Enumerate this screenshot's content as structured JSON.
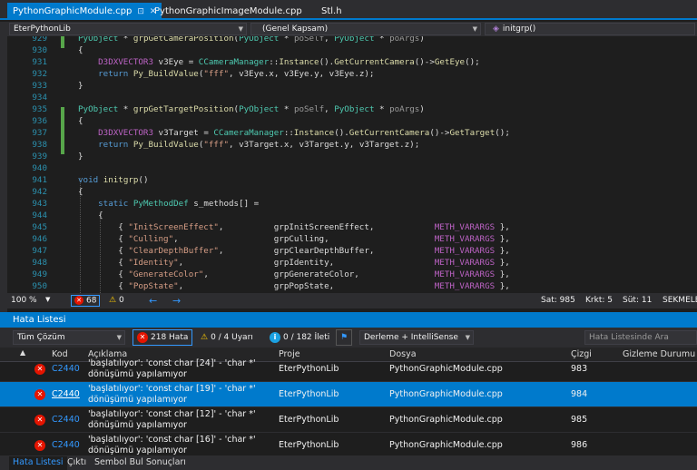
{
  "tabs": [
    {
      "label": "PythonGraphicModule.cpp",
      "active": true
    },
    {
      "label": "PythonGraphicImageModule.cpp",
      "active": false
    },
    {
      "label": "Stl.h",
      "active": false
    }
  ],
  "tab_close": "✕",
  "tab_pin": "⊡",
  "navbar": {
    "project": "EterPythonLib",
    "scope": "(Genel Kapsam)",
    "member": "initgrp()"
  },
  "code_lines": [
    {
      "n": "929",
      "t": "PyObject * grpGetCameraPosition(PyObject * poSelf, PyObject * poArgs)"
    },
    {
      "n": "930",
      "t": "{"
    },
    {
      "n": "931",
      "t": "    D3DXVECTOR3 v3Eye = CCameraManager::Instance().GetCurrentCamera()->GetEye();"
    },
    {
      "n": "932",
      "t": "    return Py_BuildValue(\"fff\", v3Eye.x, v3Eye.y, v3Eye.z);"
    },
    {
      "n": "933",
      "t": "}"
    },
    {
      "n": "934",
      "t": ""
    },
    {
      "n": "935",
      "t": "PyObject * grpGetTargetPosition(PyObject * poSelf, PyObject * poArgs)"
    },
    {
      "n": "936",
      "t": "{"
    },
    {
      "n": "937",
      "t": "    D3DXVECTOR3 v3Target = CCameraManager::Instance().GetCurrentCamera()->GetTarget();"
    },
    {
      "n": "938",
      "t": "    return Py_BuildValue(\"fff\", v3Target.x, v3Target.y, v3Target.z);"
    },
    {
      "n": "939",
      "t": "}"
    },
    {
      "n": "940",
      "t": ""
    },
    {
      "n": "941",
      "t": "void initgrp()"
    },
    {
      "n": "942",
      "t": "{"
    },
    {
      "n": "943",
      "t": "    static PyMethodDef s_methods[] ="
    },
    {
      "n": "944",
      "t": "    {"
    },
    {
      "n": "945",
      "t": "        { \"InitScreenEffect\",          grpInitScreenEffect,            METH_VARARGS },"
    },
    {
      "n": "946",
      "t": "        { \"Culling\",                   grpCulling,                     METH_VARARGS },"
    },
    {
      "n": "947",
      "t": "        { \"ClearDepthBuffer\",          grpClearDepthBuffer,            METH_VARARGS },"
    },
    {
      "n": "948",
      "t": "        { \"Identity\",                  grpIdentity,                    METH_VARARGS },"
    },
    {
      "n": "949",
      "t": "        { \"GenerateColor\",             grpGenerateColor,               METH_VARARGS },"
    },
    {
      "n": "950",
      "t": "        { \"PopState\",                  grpPopState,                    METH_VARARGS },"
    }
  ],
  "editor_status": {
    "zoom": "100 %",
    "errors": "68",
    "warnings": "0",
    "line": "Sat: 985",
    "char": "Krkt: 5",
    "col": "Süt: 11",
    "mode": "SEKMELER"
  },
  "error_list": {
    "title": "Hata Listesi",
    "scope": "Tüm Çözüm",
    "errors_btn": "218 Hata",
    "warnings_btn": "0 / 4 Uyarı",
    "messages_btn": "0 / 182 İleti",
    "build_filter": "Derleme + IntelliSense",
    "search_placeholder": "Hata Listesinde Ara",
    "columns": {
      "code": "Kod",
      "description": "Açıklama",
      "project": "Proje",
      "file": "Dosya",
      "line": "Çizgi",
      "suppression": "Gizleme Durumu"
    },
    "rows": [
      {
        "code": "C2440",
        "description": "'başlatılıyor': 'const char [24]' - 'char *' dönüşümü yapılamıyor",
        "project": "EterPythonLib",
        "file": "PythonGraphicModule.cpp",
        "line": "983",
        "selected": false
      },
      {
        "code": "C2440",
        "description": "'başlatılıyor': 'const char [19]' - 'char *' dönüşümü yapılamıyor",
        "project": "EterPythonLib",
        "file": "PythonGraphicModule.cpp",
        "line": "984",
        "selected": true
      },
      {
        "code": "C2440",
        "description": "'başlatılıyor': 'const char [12]' - 'char *' dönüşümü yapılamıyor",
        "project": "EterPythonLib",
        "file": "PythonGraphicModule.cpp",
        "line": "985",
        "selected": false
      },
      {
        "code": "C2440",
        "description": "'başlatılıyor': 'const char [16]' - 'char *' dönüşümü yapılamıyor",
        "project": "EterPythonLib",
        "file": "PythonGraphicModule.cpp",
        "line": "986",
        "selected": false
      }
    ]
  },
  "bottom_tabs": [
    {
      "label": "Hata Listesi",
      "active": true
    },
    {
      "label": "Çıktı",
      "active": false
    },
    {
      "label": "Sembol Bul Sonuçları",
      "active": false
    }
  ],
  "colors": {
    "accent": "#007acc",
    "error": "#e51400",
    "warning": "#ffcc00",
    "info": "#1ba1e2"
  }
}
